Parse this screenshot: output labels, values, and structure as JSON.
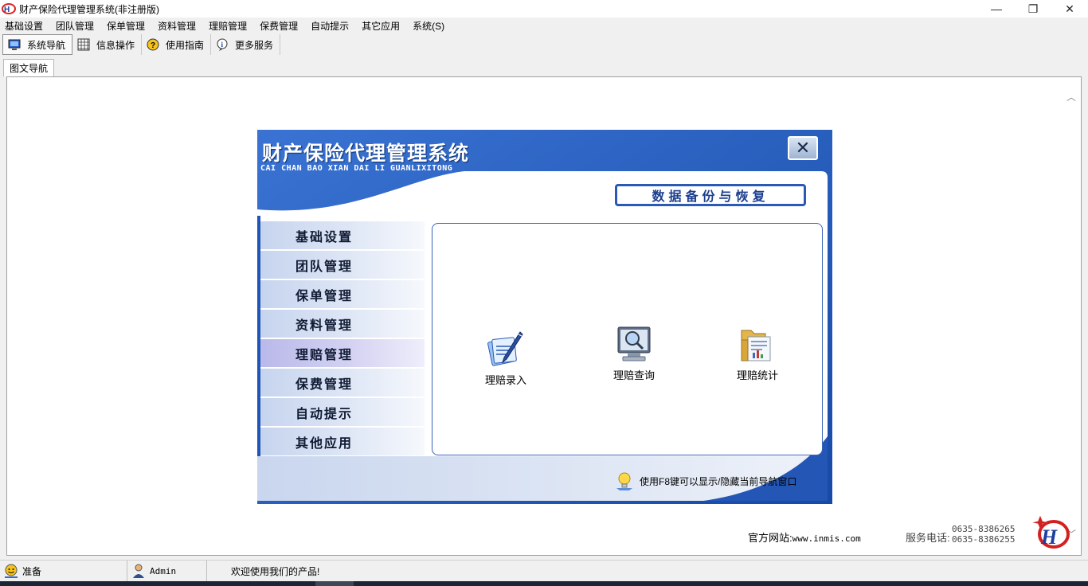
{
  "window": {
    "title": "财产保险代理管理系统(非注册版)",
    "controls": [
      "—",
      "❐",
      "✕"
    ]
  },
  "menubar": [
    "基础设置",
    "团队管理",
    "保单管理",
    "资料管理",
    "理赔管理",
    "保费管理",
    "自动提示",
    "其它应用",
    "系统(S)"
  ],
  "toolbar": [
    {
      "label": "系统导航",
      "icon": "monitor-icon",
      "active": true
    },
    {
      "label": "信息操作",
      "icon": "grid-icon",
      "active": false
    },
    {
      "label": "使用指南",
      "icon": "help-icon",
      "active": false
    },
    {
      "label": "更多服务",
      "icon": "info-icon",
      "active": false
    }
  ],
  "tab": {
    "label": "图文导航"
  },
  "nav_panel": {
    "title": "财产保险代理管理系统",
    "subtitle": "CAI CHAN BAO XIAN DAI LI GUANLIXITONG",
    "close": "✕",
    "section": "数据备份与恢复",
    "menu": [
      "基础设置",
      "团队管理",
      "保单管理",
      "资料管理",
      "理赔管理",
      "保费管理",
      "自动提示",
      "其他应用"
    ],
    "selected_index": 4,
    "functions": [
      {
        "label": "理赔录入",
        "icon": "pen-document-icon"
      },
      {
        "label": "理赔查询",
        "icon": "magnifier-monitor-icon"
      },
      {
        "label": "理赔统计",
        "icon": "folder-stats-icon"
      }
    ],
    "hint": "使用F8键可以显示/隐藏当前导航窗口"
  },
  "footer": {
    "site_label": "官方网站:",
    "site_url": "www.inmis.com",
    "phone_label": "服务电话:",
    "phones": [
      "0635-8386265",
      "0635-8386255"
    ]
  },
  "statusbar": {
    "state": "准备",
    "user": "Admin",
    "message": "欢迎使用我们的产品!"
  },
  "colors": {
    "panel_blue": "#1e55b7",
    "accent": "#2a5ab6"
  }
}
